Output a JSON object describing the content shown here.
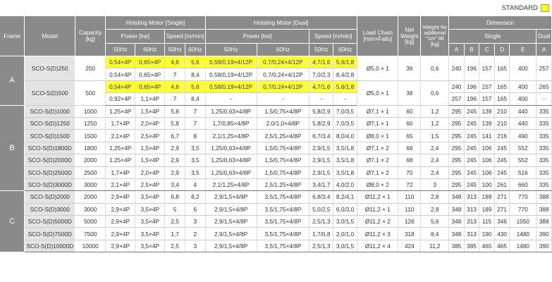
{
  "legend": {
    "label": "STANDARD",
    "color": "#ffff00"
  },
  "headers": {
    "frame": "Frame",
    "model": "Model",
    "capacity": "Capacity [kg]",
    "hoist_single": "Hoisting Motor [Single]",
    "hoist_dual": "Hoisting Motor [Dual]",
    "power_kw": "Power [kw]",
    "speed": "Speed [m/min]",
    "load_chain": "Load Chain [mm×Falls]",
    "net_weight": "Net Weight [kg]",
    "weight_lift": "Weight for additonal \"1m\" lift [kg]",
    "dimension": "Dimension",
    "single": "Single",
    "dual": "Dual",
    "hz50": "50Hz",
    "hz60": "60Hz",
    "dim_cols": [
      "A",
      "B",
      "C",
      "D",
      "E",
      "A"
    ]
  },
  "groups": [
    {
      "frame": "A",
      "models": [
        {
          "model": "SCO-S(D)250",
          "capacity": "250",
          "chain": "Ø5,0 × 1",
          "net": "36",
          "lift": "0,6",
          "rows": [
            {
              "hl": true,
              "sp50": "0,54×4P",
              "sp60": "0,65×4P",
              "ss50": "4,6",
              "ss60": "5,6",
              "dp50": "0,58/0,19×4/12P",
              "dp60": "0,7/0,24×4/12P",
              "ds50": "4,7/1,6",
              "ds60": "5,6/1,8",
              "dims": [
                "240",
                "196",
                "157",
                "165",
                "400",
                "257"
              ]
            },
            {
              "hl": false,
              "sp50": "0,54×4P",
              "sp60": "0,65×4P",
              "ss50": "7",
              "ss60": "8,4",
              "dp50": "0,58/0,19×4/12P",
              "dp60": "0,7/0,24×4/12P",
              "ds50": "7,0/2,3",
              "ds60": "8,4/2,8"
            }
          ]
        },
        {
          "model": "SCO-S(D)500",
          "capacity": "500",
          "chain": "Ø5,0 × 1",
          "net": "38",
          "lift": "0,6",
          "rows": [
            {
              "hl": true,
              "sp50": "0,54×4P",
              "sp60": "0,65×4P",
              "ss50": "4,6",
              "ss60": "5,6",
              "dp50": "0,58/0,19×4/12P",
              "dp60": "0,7/0,24×4/12P",
              "ds50": "4,7/1,6",
              "ds60": "5,6/1,8",
              "dims": [
                "240",
                "196",
                "157",
                "165",
                "400",
                "265"
              ]
            },
            {
              "hl": false,
              "sp50": "0,92×4P",
              "sp60": "1,1×4P",
              "ss50": "7",
              "ss60": "8,4",
              "dp50": "-",
              "dp60": "-",
              "ds50": "-",
              "ds60": "-",
              "dims": [
                "257",
                "196",
                "157",
                "165",
                "400",
                "-"
              ]
            }
          ]
        }
      ]
    },
    {
      "frame": "B",
      "models": [
        {
          "model": "SCO-S(D)1000",
          "capacity": "1000",
          "chain": "Ø7,1 × 1",
          "net": "60",
          "lift": "1,2",
          "rows": [
            {
              "sp50": "1,25×4P",
              "sp60": "1,5×4P",
              "ss50": "5,8",
              "ss60": "7",
              "dp50": "1,25/0,63×4/8P",
              "dp60": "1,5/0,75×4/8P",
              "ds50": "5,8/2,9",
              "ds60": "7,0/3,5",
              "dims": [
                "295",
                "245",
                "139",
                "210",
                "440",
                "335"
              ]
            }
          ]
        },
        {
          "model": "SCO-S(D)1250",
          "capacity": "1250",
          "chain": "Ø7,1 × 1",
          "net": "60",
          "lift": "1,2",
          "rows": [
            {
              "sp50": "1,7×4P",
              "sp60": "2,0×4P",
              "ss50": "5,8",
              "ss60": "7",
              "dp50": "1,7/0,85×4/8P",
              "dp60": "2,0/1,0×4/8P",
              "ds50": "5,8/2,9",
              "ds60": "7,0/3,5",
              "dims": [
                "295",
                "245",
                "139",
                "210",
                "440",
                "335"
              ]
            }
          ]
        },
        {
          "model": "SCO-S(D)1500",
          "capacity": "1500",
          "chain": "Ø8,0 × 1",
          "net": "65",
          "lift": "1,5",
          "rows": [
            {
              "sp50": "2,1×4P",
              "sp60": "2,5×4P",
              "ss50": "6,7",
              "ss60": "8",
              "dp50": "2,1/1,25×4/8P",
              "dp60": "2,5/1,25×4/8P",
              "ds50": "6,7/3,4",
              "ds60": "8,0/4,0",
              "dims": [
                "295",
                "245",
                "141",
                "216",
                "490",
                "335"
              ]
            }
          ]
        },
        {
          "model": "SCO-S(D)1800D",
          "capacity": "1800",
          "chain": "Ø7,1 × 2",
          "net": "68",
          "lift": "2,4",
          "rows": [
            {
              "sp50": "1,25×4P",
              "sp60": "1,5×4P",
              "ss50": "2,9",
              "ss60": "3,5",
              "dp50": "1,25/0,63×4/8P",
              "dp60": "1,5/0,75×4/8P",
              "ds50": "2,9/1,5",
              "ds60": "3,5/1,8",
              "dims": [
                "295",
                "245",
                "106",
                "245",
                "552",
                "335"
              ]
            }
          ]
        },
        {
          "model": "SCO-S(D)2000D",
          "capacity": "2000",
          "chain": "Ø7,1 × 2",
          "net": "68",
          "lift": "2,4",
          "rows": [
            {
              "sp50": "1,25×4P",
              "sp60": "1,5×4P",
              "ss50": "2,9",
              "ss60": "3,5",
              "dp50": "1,25/0,63×4/8P",
              "dp60": "1,5/0,75×4/8P",
              "ds50": "2,9/1,5",
              "ds60": "3,5/1,8",
              "dims": [
                "295",
                "245",
                "106",
                "245",
                "552",
                "335"
              ]
            }
          ]
        },
        {
          "model": "SCO-S(D)2500D",
          "capacity": "2500",
          "chain": "Ø7,1 × 2",
          "net": "70",
          "lift": "2,4",
          "rows": [
            {
              "sp50": "1,7×4P",
              "sp60": "2,0×4P",
              "ss50": "2,9",
              "ss60": "3,5",
              "dp50": "1,25/0,63×4/8P",
              "dp60": "1,5/0,75×4/8P",
              "ds50": "2,9/1,5",
              "ds60": "3,5/1,8",
              "dims": [
                "295",
                "245",
                "106",
                "245",
                "516",
                "335"
              ]
            }
          ]
        },
        {
          "model": "SCO-S(D)3000D",
          "capacity": "3000",
          "chain": "Ø8,0 × 2",
          "net": "72",
          "lift": "3",
          "rows": [
            {
              "sp50": "2,1×4P",
              "sp60": "2,5×4P",
              "ss50": "3,4",
              "ss60": "4",
              "dp50": "2,1/1,25×4/8P",
              "dp60": "2,5/1,25×4/8P",
              "ds50": "3,4/1,7",
              "ds60": "4,0/2,0",
              "dims": [
                "295",
                "245",
                "100",
                "261",
                "660",
                "335"
              ]
            }
          ]
        }
      ]
    },
    {
      "frame": "C",
      "models": [
        {
          "model": "SCO-S(D)2000",
          "capacity": "2000",
          "chain": "Ø11,2 × 1",
          "net": "110",
          "lift": "2,8",
          "rows": [
            {
              "sp50": "2,9×4P",
              "sp60": "3,5×4P",
              "ss50": "6,8",
              "ss60": "8,2",
              "dp50": "2,9/1,5×4/8P",
              "dp60": "3,5/1,75×4/8P",
              "ds50": "6,8/3,4",
              "ds60": "8,2/4,1",
              "dims": [
                "348",
                "313",
                "189",
                "271",
                "770",
                "388"
              ]
            }
          ]
        },
        {
          "model": "SCO-S(D)3000",
          "capacity": "3000",
          "chain": "Ø11,2 × 1",
          "net": "110",
          "lift": "2,8",
          "rows": [
            {
              "sp50": "2,9×4P",
              "sp60": "3,5×4P",
              "ss50": "5",
              "ss60": "6",
              "dp50": "2,9/1,5×4/8P",
              "dp60": "3,5/1,75×4/8P",
              "ds50": "5,0/2,5",
              "ds60": "6,0/3,0",
              "dims": [
                "348",
                "313",
                "189",
                "271",
                "770",
                "388"
              ]
            }
          ]
        },
        {
          "model": "SCO-S(D)5000D",
          "capacity": "5000",
          "chain": "Ø11,2 × 2",
          "net": "126",
          "lift": "5,6",
          "rows": [
            {
              "sp50": "2,9×4P",
              "sp60": "3,5×4P",
              "ss50": "2,5",
              "ss60": "3",
              "dp50": "2,9/1,5×4/8P",
              "dp60": "3,5/1,75×4/8P",
              "ds50": "2,5/1,3",
              "ds60": "3,0/1,5",
              "dims": [
                "348",
                "313",
                "115",
                "346",
                "1050",
                "388"
              ]
            }
          ]
        },
        {
          "model": "SCO-S(D)7500D",
          "capacity": "7500",
          "chain": "Ø11,2 × 3",
          "net": "318",
          "lift": "8,4",
          "rows": [
            {
              "sp50": "2,9×4P",
              "sp60": "3,5×4P",
              "ss50": "1,7",
              "ss60": "2",
              "dp50": "2,9/1,5×4/8P",
              "dp60": "3,5/1,75×4/8P",
              "ds50": "1,7/0,8",
              "ds60": "2,0/1,0",
              "dims": [
                "348",
                "313",
                "190",
                "430",
                "1480",
                "390"
              ]
            }
          ]
        },
        {
          "model": "SCO-S(D)10000D",
          "capacity": "10000",
          "chain": "Ø11,2 × 4",
          "net": "424",
          "lift": "11,2",
          "rows": [
            {
              "sp50": "2,9×4P",
              "sp60": "3,5×4P",
              "ss50": "2,5",
              "ss60": "3",
              "dp50": "2,9/1,5×4/8P",
              "dp60": "3,5/1,75×4/8P",
              "ds50": "2,5/1,3",
              "ds60": "3,0/1,5",
              "dims": [
                "385",
                "385",
                "465",
                "465",
                "1480",
                "390"
              ]
            }
          ]
        }
      ]
    }
  ]
}
